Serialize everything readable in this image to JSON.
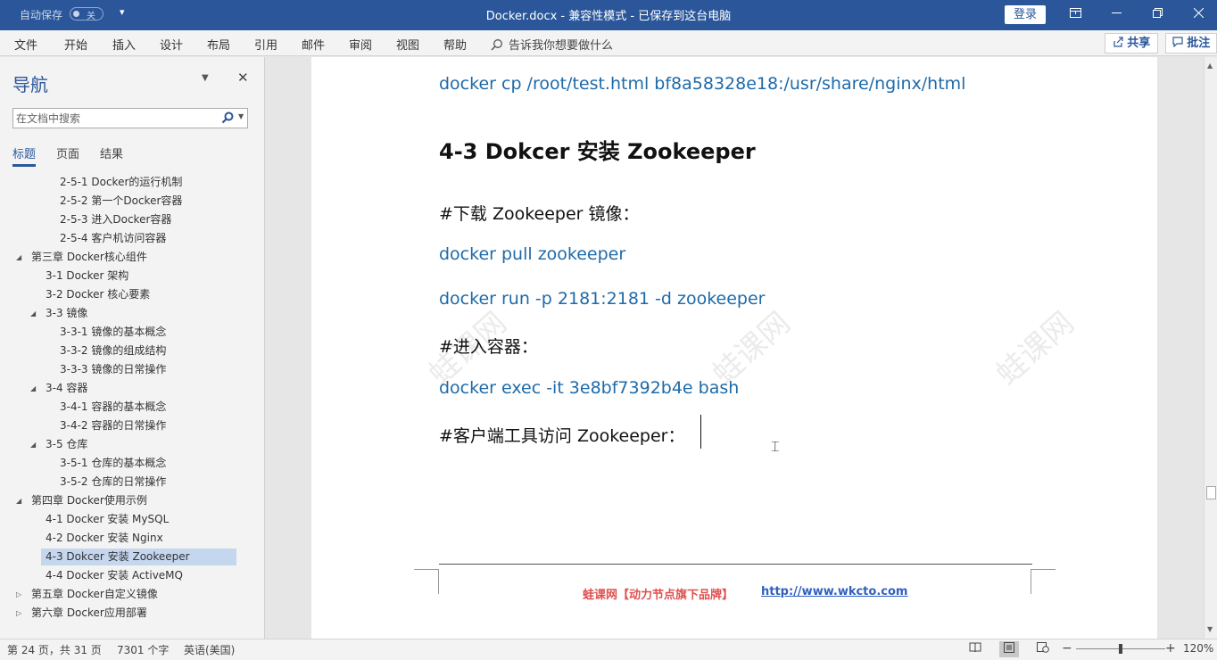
{
  "titlebar": {
    "autosave_label": "自动保存",
    "autosave_state": "关",
    "title": "Docker.docx  -  兼容性模式  - 已保存到这台电脑",
    "login_label": "登录",
    "color": "#2b579a"
  },
  "menu": {
    "items": [
      "文件",
      "开始",
      "插入",
      "设计",
      "布局",
      "引用",
      "邮件",
      "审阅",
      "视图",
      "帮助"
    ],
    "tell_me": "告诉我你想要做什么",
    "share_label": "共享",
    "comment_label": "批注"
  },
  "nav": {
    "title": "导航",
    "search_placeholder": "在文档中搜索",
    "tabs": [
      "标题",
      "页面",
      "结果"
    ],
    "active_tab": 0,
    "tree": [
      {
        "label": "2-5-1 Docker的运行机制",
        "level": 3,
        "expander": "none"
      },
      {
        "label": "2-5-2 第一个Docker容器",
        "level": 3,
        "expander": "none"
      },
      {
        "label": "2-5-3 进入Docker容器",
        "level": 3,
        "expander": "none"
      },
      {
        "label": "2-5-4 客户机访问容器",
        "level": 3,
        "expander": "none"
      },
      {
        "label": "第三章 Docker核心组件",
        "level": 1,
        "expander": "expanded"
      },
      {
        "label": "3-1 Docker 架构",
        "level": 2,
        "expander": "none"
      },
      {
        "label": "3-2 Docker 核心要素",
        "level": 2,
        "expander": "none"
      },
      {
        "label": "3-3 镜像",
        "level": 2,
        "expander": "expanded"
      },
      {
        "label": "3-3-1 镜像的基本概念",
        "level": 3,
        "expander": "none"
      },
      {
        "label": "3-3-2 镜像的组成结构",
        "level": 3,
        "expander": "none"
      },
      {
        "label": "3-3-3 镜像的日常操作",
        "level": 3,
        "expander": "none"
      },
      {
        "label": "3-4 容器",
        "level": 2,
        "expander": "expanded"
      },
      {
        "label": "3-4-1 容器的基本概念",
        "level": 3,
        "expander": "none"
      },
      {
        "label": "3-4-2 容器的日常操作",
        "level": 3,
        "expander": "none"
      },
      {
        "label": "3-5 仓库",
        "level": 2,
        "expander": "expanded"
      },
      {
        "label": "3-5-1 仓库的基本概念",
        "level": 3,
        "expander": "none"
      },
      {
        "label": "3-5-2 仓库的日常操作",
        "level": 3,
        "expander": "none"
      },
      {
        "label": "第四章 Docker使用示例",
        "level": 1,
        "expander": "expanded"
      },
      {
        "label": "4-1 Docker 安装 MySQL",
        "level": 2,
        "expander": "none"
      },
      {
        "label": "4-2 Docker 安装 Nginx",
        "level": 2,
        "expander": "none"
      },
      {
        "label": "4-3 Dokcer 安装 Zookeeper",
        "level": 2,
        "expander": "none",
        "selected": true
      },
      {
        "label": "4-4 Docker 安装 ActiveMQ",
        "level": 2,
        "expander": "none"
      },
      {
        "label": "第五章 Docker自定义镜像",
        "level": 1,
        "expander": "collapsed"
      },
      {
        "label": "第六章 Docker应用部署",
        "level": 1,
        "expander": "collapsed"
      }
    ]
  },
  "document": {
    "cmd_cp": "docker cp /root/test.html bf8a58328e18:/usr/share/nginx/html",
    "heading": "4-3 Dokcer  安装  Zookeeper",
    "note_download": "#下载 Zookeeper 镜像：",
    "cmd_pull": "docker pull zookeeper",
    "cmd_run": "docker run -p 2181:2181 -d zookeeper",
    "note_enter": "#进入容器：",
    "cmd_exec": "docker exec -it 3e8bf7392b4e bash",
    "note_client": "#客户端工具访问 Zookeeper：",
    "watermark": "蛙课网",
    "footer_brand": "蛙课网【动力节点旗下品牌】",
    "footer_link": "http://www.wkcto.com",
    "command_color": "#1e6aa9"
  },
  "status": {
    "page_info": "第 24 页，共 31 页",
    "word_count": "7301 个字",
    "language": "英语(美国)",
    "zoom": "120%"
  }
}
